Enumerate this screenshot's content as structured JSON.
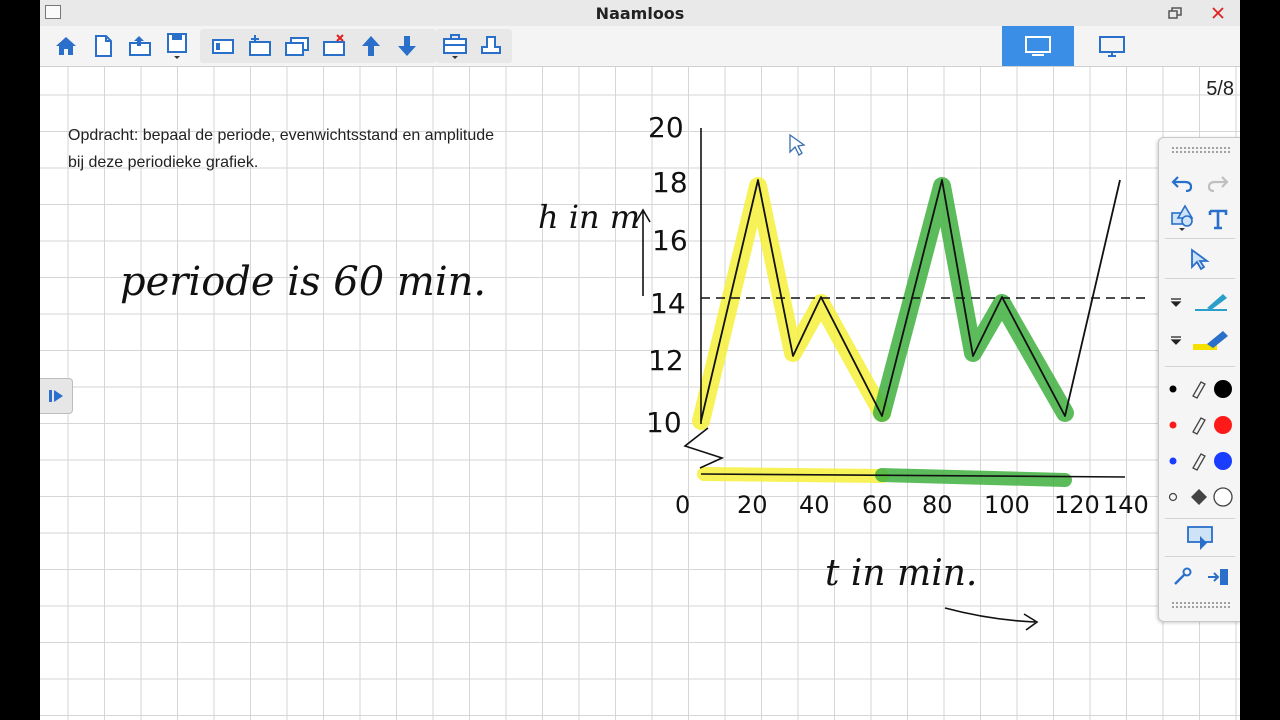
{
  "window": {
    "title": "Naamloos"
  },
  "toolbar": {
    "buttons": [
      "home-icon",
      "new-page-icon",
      "open-icon",
      "save-icon",
      "slide-icon",
      "add-page-icon",
      "duplicate-page-icon",
      "delete-page-icon",
      "arrow-up-icon",
      "arrow-down-icon",
      "toolbox-icon",
      "scanner-icon"
    ],
    "modes": [
      "whiteboard-mode-icon",
      "desktop-mode-icon"
    ],
    "window_controls": [
      "restore-icon",
      "close-icon"
    ]
  },
  "page": {
    "counter": "5/8"
  },
  "assignment": {
    "text": "Opdracht: bepaal de periode, evenwichtsstand en amplitude bij deze periodieke grafiek."
  },
  "handwriting": {
    "answer": "periode is 60 min.",
    "y_axis_label": "h in m",
    "x_axis_label": "t in min.",
    "y_ticks": [
      "10",
      "12",
      "14",
      "16",
      "18",
      "20"
    ],
    "x_ticks": [
      "0",
      "20",
      "40",
      "60",
      "80",
      "100",
      "120",
      "140"
    ]
  },
  "graph_points": {
    "t": [
      0,
      20,
      30,
      40,
      60,
      80,
      90,
      100,
      120,
      140
    ],
    "h": [
      10,
      18,
      12,
      14,
      10,
      18,
      12,
      14,
      10,
      18
    ]
  },
  "equilibrium_line": 14,
  "colors": {
    "highlight_yellow": "#f5f03a",
    "highlight_green": "#3fb040",
    "ink": "#111111",
    "mode_active": "#3a8ee6",
    "pen_red": "#ff1a1a",
    "pen_blue": "#1a3cff"
  },
  "right_panel": {
    "tools": [
      "undo-icon",
      "redo-icon",
      "shapes-icon",
      "text-icon",
      "select-icon",
      "pen-icon",
      "highlighter-icon",
      "black-pen-icon",
      "red-pen-icon",
      "blue-pen-icon",
      "fill-icon",
      "screen-capture-icon",
      "settings-icon",
      "collapse-panel-icon"
    ]
  }
}
